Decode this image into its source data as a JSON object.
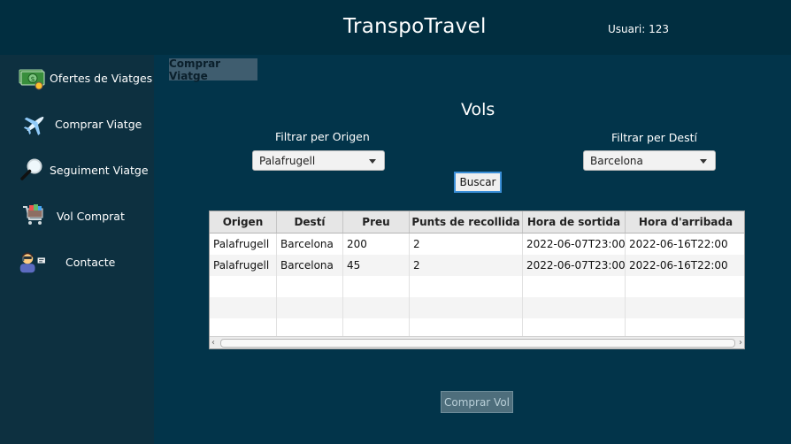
{
  "header": {
    "title": "TranspoTravel",
    "user_label": "Usuari:",
    "user_id": "123"
  },
  "sidebar": {
    "items": [
      {
        "label": "Ofertes de Viatges",
        "icon": "money-icon"
      },
      {
        "label": "Comprar Viatge",
        "icon": "airplane-icon"
      },
      {
        "label": "Seguiment Viatge",
        "icon": "magnifier-icon"
      },
      {
        "label": "Vol Comprat",
        "icon": "shopping-cart-icon"
      },
      {
        "label": "Contacte",
        "icon": "contact-person-icon"
      }
    ]
  },
  "main": {
    "tab_label": "Comprar Viatge",
    "section_title": "Vols",
    "filter_origin": {
      "label": "Filtrar per Origen",
      "value": "Palafrugell"
    },
    "filter_destination": {
      "label": "Filtrar per Destí",
      "value": "Barcelona"
    },
    "search_button": "Buscar",
    "buy_button": "Comprar Vol"
  },
  "table": {
    "columns": [
      "Origen",
      "Destí",
      "Preu",
      "Punts de recollida",
      "Hora de sortida",
      "Hora d'arribada"
    ],
    "rows": [
      [
        "Palafrugell",
        "Barcelona",
        "200",
        "2",
        "2022-06-07T23:00",
        "2022-06-16T22:00"
      ],
      [
        "Palafrugell",
        "Barcelona",
        "45",
        "2",
        "2022-06-07T23:00",
        "2022-06-16T22:00"
      ]
    ]
  },
  "colors": {
    "background": "#012e40",
    "sidebar": "#0d3040",
    "main": "#02344a",
    "accent": "#3b8fd8"
  }
}
